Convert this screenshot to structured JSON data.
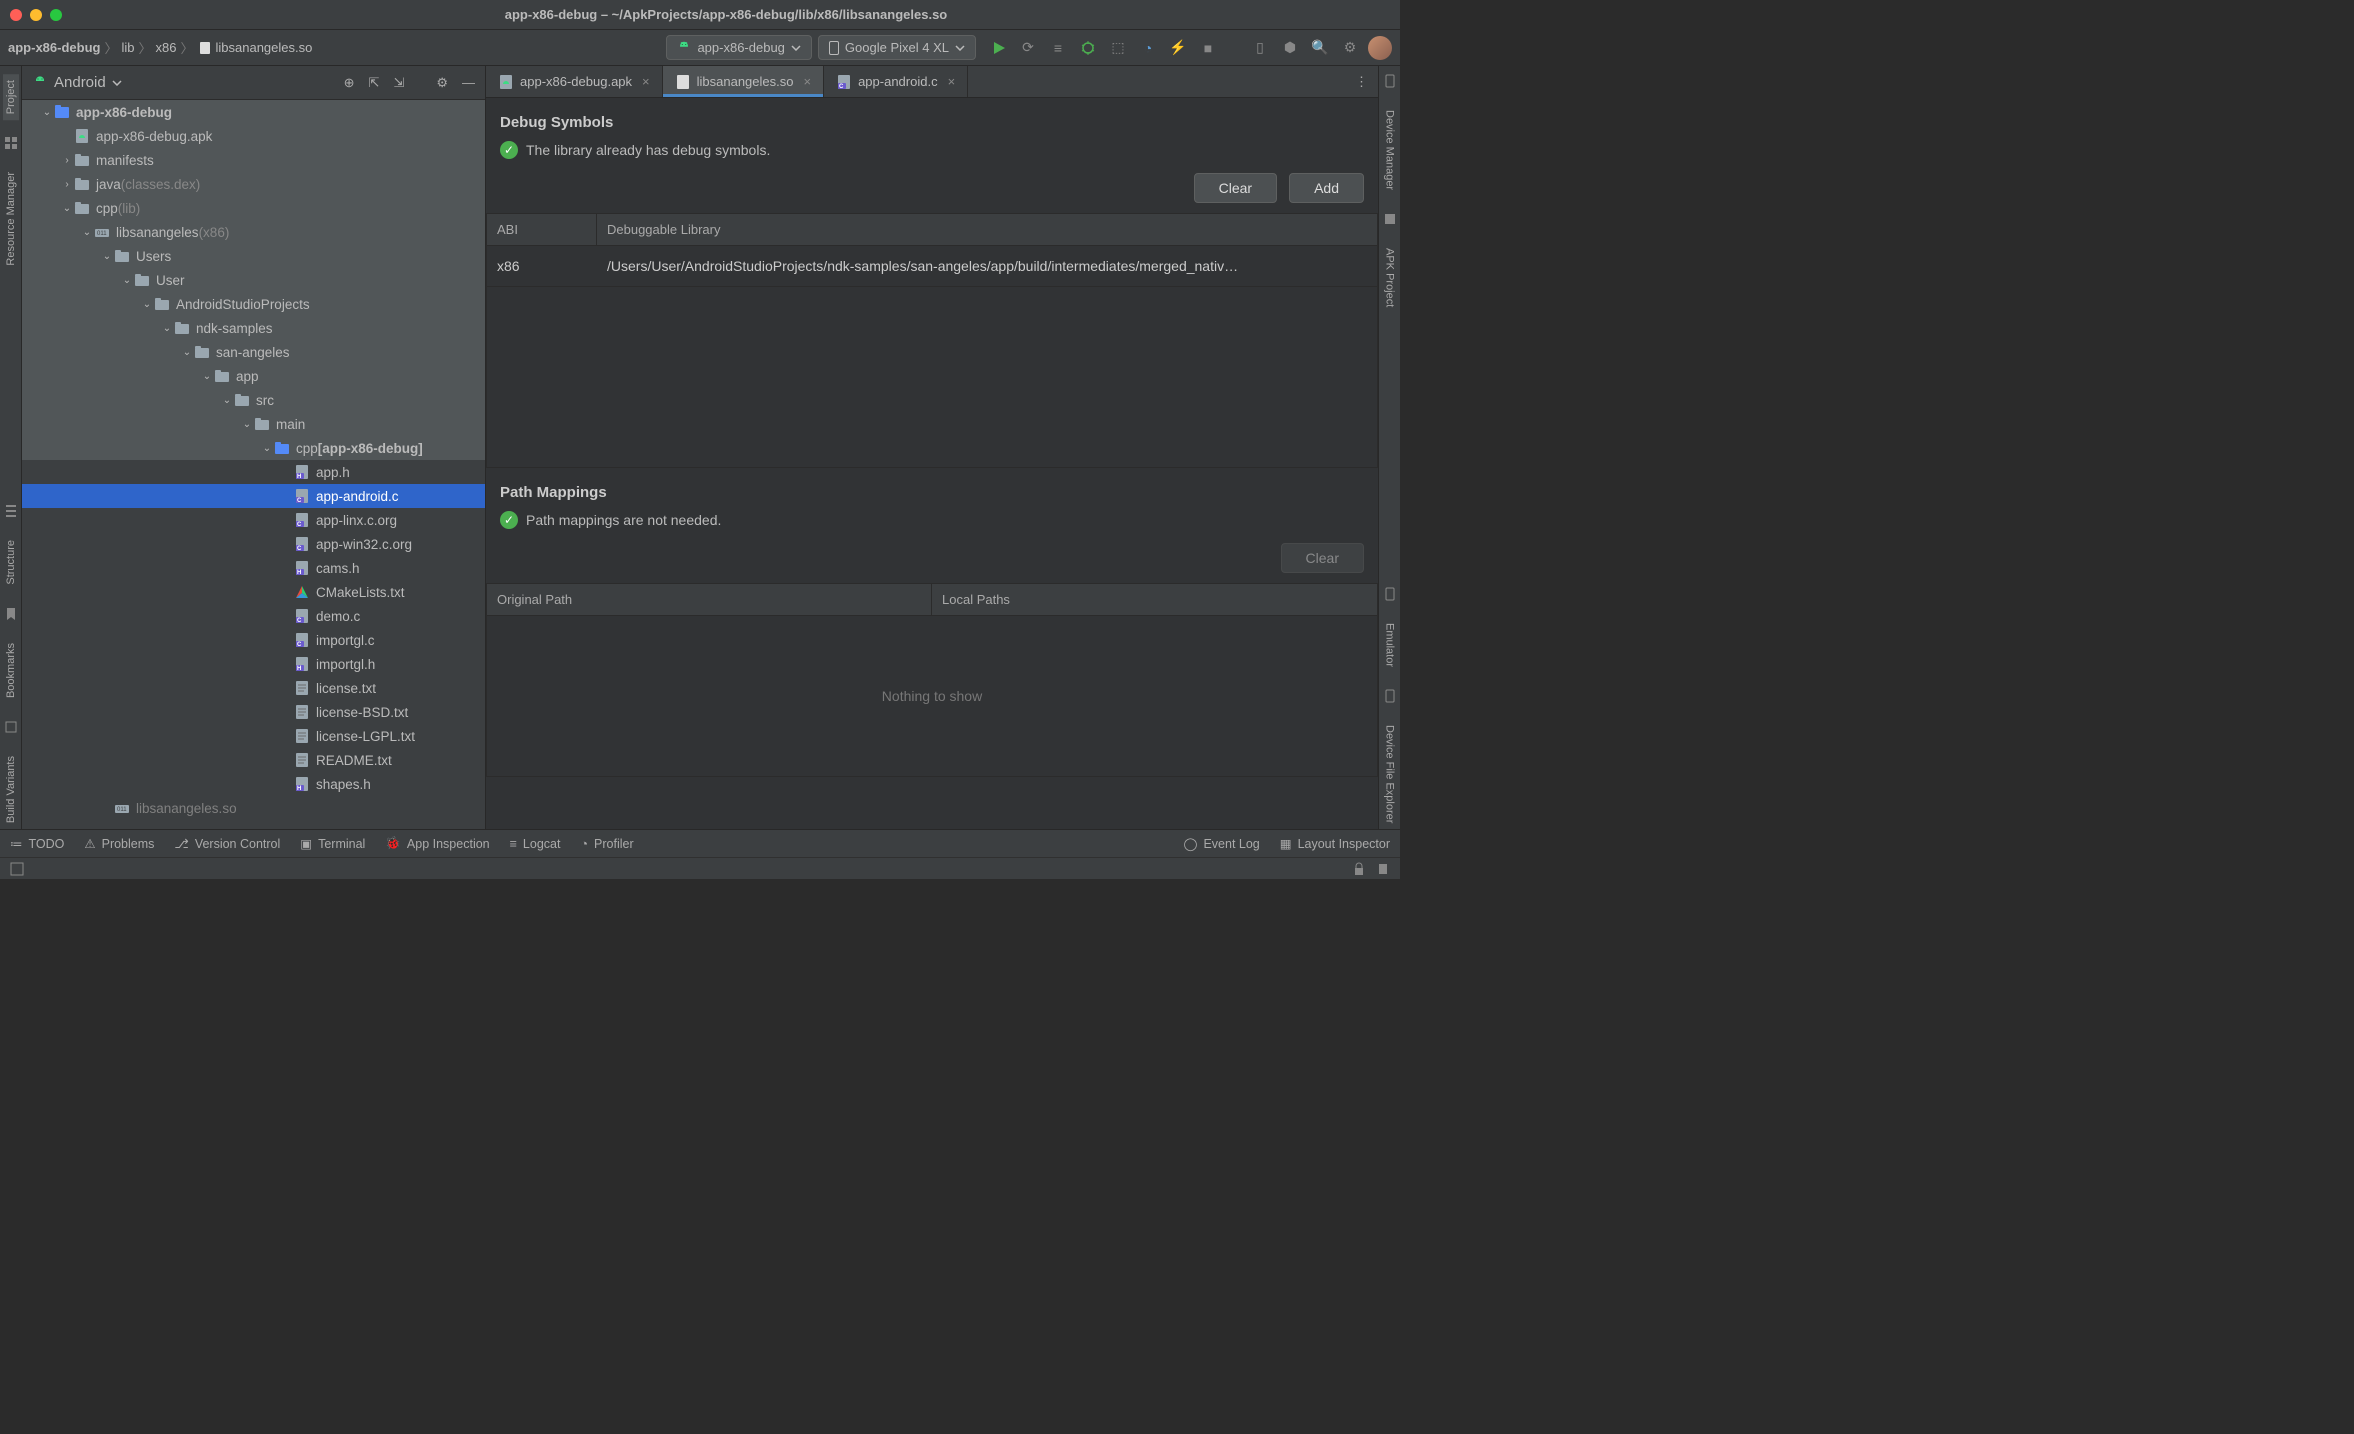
{
  "window": {
    "title": "app-x86-debug – ~/ApkProjects/app-x86-debug/lib/x86/libsanangeles.so"
  },
  "breadcrumbs": [
    "app-x86-debug",
    "lib",
    "x86",
    "libsanangeles.so"
  ],
  "runconfig": "app-x86-debug",
  "device": "Google Pixel 4 XL",
  "projectView": "Android",
  "left_tabs": [
    "Project",
    "Resource Manager",
    "Structure",
    "Bookmarks",
    "Build Variants"
  ],
  "right_tabs": [
    "Device Manager",
    "APK Project",
    "Emulator",
    "Device File Explorer"
  ],
  "tree": [
    {
      "d": 0,
      "exp": true,
      "icon": "module",
      "label": "app-x86-debug",
      "bold": true,
      "hl": true
    },
    {
      "d": 1,
      "exp": null,
      "icon": "apk",
      "label": "app-x86-debug.apk",
      "hl": true
    },
    {
      "d": 1,
      "exp": false,
      "icon": "folder",
      "label": "manifests",
      "hl": true
    },
    {
      "d": 1,
      "exp": false,
      "icon": "folder",
      "label": "java",
      "suffix": "(classes.dex)",
      "hl": true
    },
    {
      "d": 1,
      "exp": true,
      "icon": "folder",
      "label": "cpp",
      "suffix": "(lib)",
      "hl": true
    },
    {
      "d": 2,
      "exp": true,
      "icon": "lib",
      "label": "libsanangeles",
      "suffix": "(x86)",
      "hl": true
    },
    {
      "d": 3,
      "exp": true,
      "icon": "folder",
      "label": "Users",
      "hl": true
    },
    {
      "d": 4,
      "exp": true,
      "icon": "folder",
      "label": "User",
      "hl": true
    },
    {
      "d": 5,
      "exp": true,
      "icon": "folder",
      "label": "AndroidStudioProjects",
      "hl": true
    },
    {
      "d": 6,
      "exp": true,
      "icon": "folder",
      "label": "ndk-samples",
      "hl": true
    },
    {
      "d": 7,
      "exp": true,
      "icon": "folder",
      "label": "san-angeles",
      "hl": true
    },
    {
      "d": 8,
      "exp": true,
      "icon": "folder",
      "label": "app",
      "hl": true
    },
    {
      "d": 9,
      "exp": true,
      "icon": "folder",
      "label": "src",
      "hl": true
    },
    {
      "d": 10,
      "exp": true,
      "icon": "folder",
      "label": "main",
      "hl": true
    },
    {
      "d": 11,
      "exp": true,
      "icon": "cppfolder",
      "label": "cpp",
      "suffix": "[app-x86-debug]",
      "hl": true,
      "suffixBold": true
    },
    {
      "d": 12,
      "icon": "h",
      "label": "app.h"
    },
    {
      "d": 12,
      "icon": "c",
      "label": "app-android.c",
      "sel": true
    },
    {
      "d": 12,
      "icon": "c",
      "label": "app-linx.c.org"
    },
    {
      "d": 12,
      "icon": "c",
      "label": "app-win32.c.org"
    },
    {
      "d": 12,
      "icon": "h",
      "label": "cams.h"
    },
    {
      "d": 12,
      "icon": "cmake",
      "label": "CMakeLists.txt"
    },
    {
      "d": 12,
      "icon": "c",
      "label": "demo.c"
    },
    {
      "d": 12,
      "icon": "c",
      "label": "importgl.c"
    },
    {
      "d": 12,
      "icon": "h",
      "label": "importgl.h"
    },
    {
      "d": 12,
      "icon": "txt",
      "label": "license.txt"
    },
    {
      "d": 12,
      "icon": "txt",
      "label": "license-BSD.txt"
    },
    {
      "d": 12,
      "icon": "txt",
      "label": "license-LGPL.txt"
    },
    {
      "d": 12,
      "icon": "txt",
      "label": "README.txt"
    },
    {
      "d": 12,
      "icon": "h",
      "label": "shapes.h"
    },
    {
      "d": 3,
      "icon": "lib",
      "label": "libsanangeles.so",
      "dim": true
    }
  ],
  "editor_tabs": [
    {
      "icon": "apk",
      "label": "app-x86-debug.apk",
      "active": false
    },
    {
      "icon": "so",
      "label": "libsanangeles.so",
      "active": true
    },
    {
      "icon": "c",
      "label": "app-android.c",
      "active": false
    }
  ],
  "debug_symbols": {
    "title": "Debug Symbols",
    "status": "The library already has debug symbols.",
    "clear": "Clear",
    "add": "Add",
    "columns": [
      "ABI",
      "Debuggable Library"
    ],
    "rows": [
      {
        "abi": "x86",
        "lib": "/Users/User/AndroidStudioProjects/ndk-samples/san-angeles/app/build/intermediates/merged_nativ…"
      }
    ]
  },
  "path_mappings": {
    "title": "Path Mappings",
    "status": "Path mappings are not needed.",
    "clear": "Clear",
    "columns": [
      "Original Path",
      "Local Paths"
    ],
    "empty": "Nothing to show"
  },
  "bottom": [
    {
      "icon": "todo",
      "label": "TODO"
    },
    {
      "icon": "problems",
      "label": "Problems"
    },
    {
      "icon": "vcs",
      "label": "Version Control"
    },
    {
      "icon": "terminal",
      "label": "Terminal"
    },
    {
      "icon": "inspect",
      "label": "App Inspection"
    },
    {
      "icon": "logcat",
      "label": "Logcat"
    },
    {
      "icon": "profiler",
      "label": "Profiler"
    }
  ],
  "bottom_right": [
    {
      "icon": "event",
      "label": "Event Log"
    },
    {
      "icon": "layout",
      "label": "Layout Inspector"
    }
  ]
}
